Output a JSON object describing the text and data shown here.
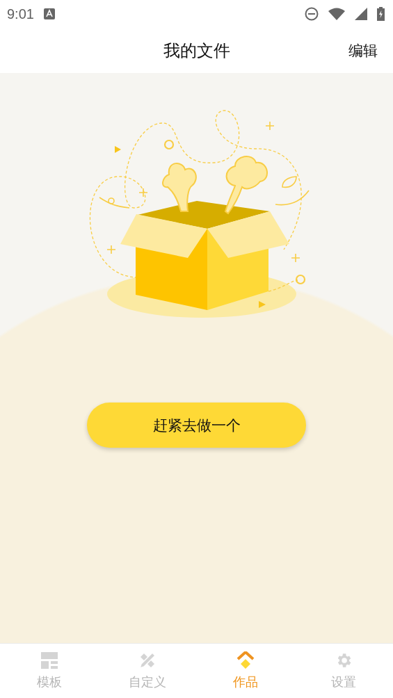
{
  "status_bar": {
    "time": "9:01"
  },
  "header": {
    "title": "我的文件",
    "action": "编辑"
  },
  "empty_state": {
    "button": "赶紧去做一个"
  },
  "bottom_nav": [
    {
      "label": "模板",
      "kind": "layout",
      "selected": false
    },
    {
      "label": "自定义",
      "kind": "tools",
      "selected": false
    },
    {
      "label": "作品",
      "kind": "works",
      "selected": true
    },
    {
      "label": "设置",
      "kind": "gear",
      "selected": false
    }
  ]
}
